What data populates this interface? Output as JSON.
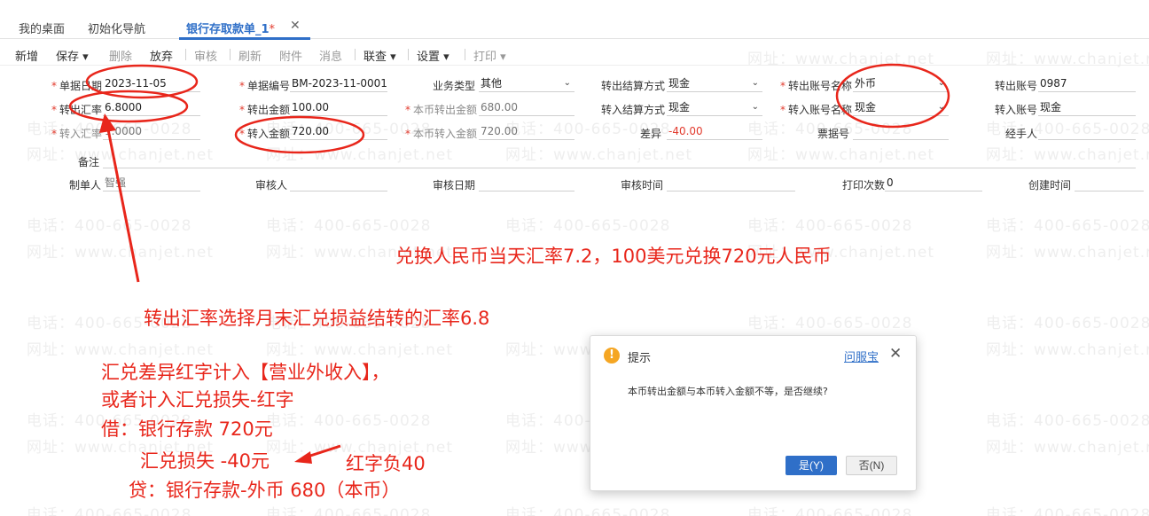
{
  "watermark": {
    "phone": "电话：400-665-0028",
    "site": "网址：www.chanjet.net"
  },
  "tabs": [
    {
      "label": "我的桌面"
    },
    {
      "label": "初始化导航"
    },
    {
      "label": "银行存取款单_1",
      "modified_mark": "*"
    }
  ],
  "toolbar": {
    "new": "新增",
    "save": "保存",
    "delete": "删除",
    "discard": "放弃",
    "approve": "审核",
    "refresh": "刷新",
    "attachment": "附件",
    "message": "消息",
    "lookup": "联查",
    "settings": "设置",
    "print": "打印"
  },
  "form": {
    "doc_date": {
      "label": "单据日期",
      "value": "2023-11-05"
    },
    "doc_no": {
      "label": "单据编号",
      "value": "BM-2023-11-0001"
    },
    "biz_type": {
      "label": "业务类型",
      "value": "其他"
    },
    "out_settle": {
      "label": "转出结算方式",
      "value": "现金"
    },
    "out_account_name": {
      "label": "转出账号名称",
      "value": "外币"
    },
    "out_account_no": {
      "label": "转出账号",
      "value": "0987"
    },
    "out_rate": {
      "label": "转出汇率",
      "value": "6.8000"
    },
    "out_amount": {
      "label": "转出金额",
      "value": "100.00"
    },
    "local_out_amount": {
      "label": "本币转出金额",
      "value": "680.00"
    },
    "in_settle": {
      "label": "转入结算方式",
      "value": "现金"
    },
    "in_account_name": {
      "label": "转入账号名称",
      "value": "现金"
    },
    "in_account_no": {
      "label": "转入账号",
      "value": "现金"
    },
    "in_rate": {
      "label": "转入汇率",
      "value": "1.0000"
    },
    "in_amount": {
      "label": "转入金额",
      "value": "720.00"
    },
    "local_in_amount": {
      "label": "本币转入金额",
      "value": "720.00"
    },
    "difference": {
      "label": "差异",
      "value": "-40.00"
    },
    "voucher_no": {
      "label": "票据号",
      "value": ""
    },
    "handler": {
      "label": "经手人",
      "value": ""
    },
    "remark": {
      "label": "备注",
      "value": ""
    },
    "maker": {
      "label": "制单人",
      "value": "智强"
    },
    "reviewer": {
      "label": "审核人",
      "value": ""
    },
    "review_date": {
      "label": "审核日期",
      "value": ""
    },
    "review_time": {
      "label": "审核时间",
      "value": ""
    },
    "print_count": {
      "label": "打印次数",
      "value": "0"
    },
    "create_time": {
      "label": "创建时间",
      "value": ""
    }
  },
  "annotations": {
    "rate_note": "兑换人民币当天汇率7.2，100美元兑换720元人民币",
    "out_rate_note": "转出汇率选择月末汇兑损益结转的汇率6.8",
    "diff_line1": "汇兑差异红字计入【营业外收入】，",
    "diff_line2": "或者计入汇兑损失-红字",
    "debit_bank": "借：银行存款   720元",
    "fx_loss": "汇兑损失 -40元",
    "red_neg": "红字负40",
    "credit": "贷：银行存款-外币  680（本币）",
    "color": "#e8261b"
  },
  "dialog": {
    "title": "提示",
    "help_link": "问服宝",
    "message": "本币转出金额与本币转入金额不等，是否继续?",
    "yes_label": "是(Y)",
    "no_label": "否(N)"
  }
}
